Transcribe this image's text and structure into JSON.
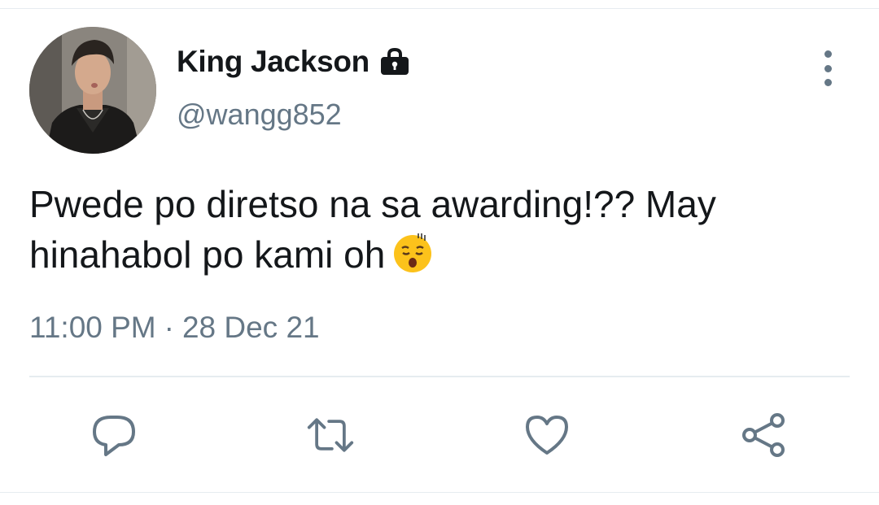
{
  "tweet": {
    "author": {
      "display_name": "King Jackson",
      "handle": "@wangg852",
      "protected_icon": "lock-icon"
    },
    "text_lines": [
      "Pwede po diretso na sa awarding!?? May",
      "hinahabol po kami oh"
    ],
    "emoji": "😫",
    "time": "11:00 PM",
    "separator": "·",
    "date": "28 Dec 21"
  },
  "actions": {
    "reply_icon": "reply-icon",
    "retweet_icon": "retweet-icon",
    "like_icon": "heart-icon",
    "share_icon": "share-icon",
    "more_icon": "more-vertical-icon"
  },
  "colors": {
    "text_primary": "#14171a",
    "text_secondary": "#657786",
    "divider": "#e6ecf0",
    "icon": "#657786"
  }
}
